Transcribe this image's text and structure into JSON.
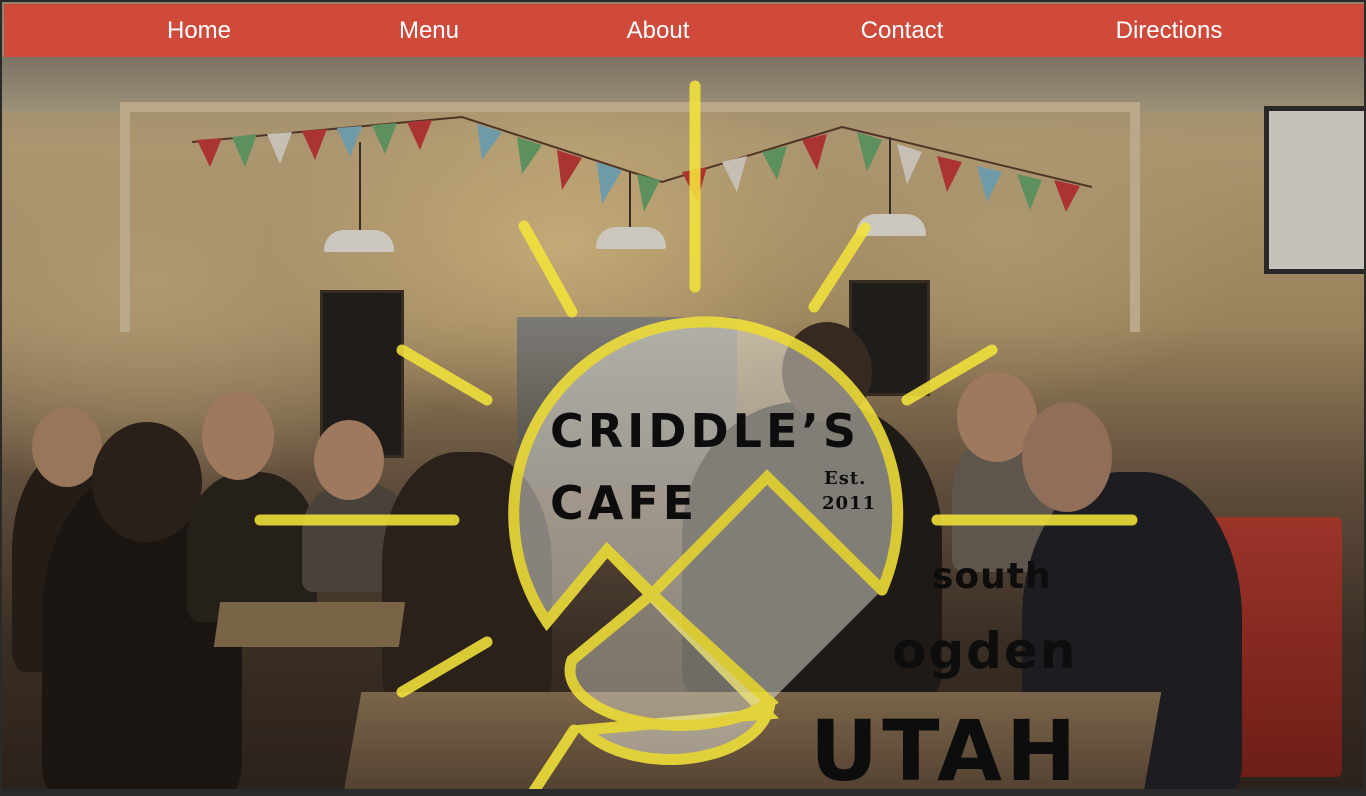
{
  "nav": {
    "items": [
      {
        "label": "Home"
      },
      {
        "label": "Menu"
      },
      {
        "label": "About"
      },
      {
        "label": "Contact"
      },
      {
        "label": "Directions"
      }
    ]
  },
  "logo": {
    "name_line1": "CRIDDLE’S",
    "name_line2": "CAFE",
    "est_label": "Est.",
    "est_year": "2011",
    "location_line1": "south",
    "location_line2": "ogden",
    "location_line3": "UTAH"
  },
  "colors": {
    "nav_bg": "#cf4a3a",
    "nav_text": "#ffffff",
    "sun_yellow": "#f2e23a",
    "logo_text": "#0d0d0d"
  }
}
